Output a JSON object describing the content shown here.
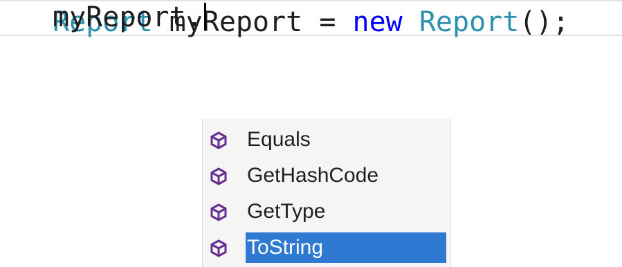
{
  "editor": {
    "line1": {
      "type_name": "Report",
      "space1": " ",
      "identifier": "myReport",
      "assign": " = ",
      "keyword": "new",
      "space2": " ",
      "constructor": "Report",
      "tail": "();"
    },
    "line2": {
      "text": "myReport."
    }
  },
  "completion": {
    "items": [
      {
        "label": "Equals",
        "icon": "method-icon"
      },
      {
        "label": "GetHashCode",
        "icon": "method-icon"
      },
      {
        "label": "GetType",
        "icon": "method-icon"
      },
      {
        "label": "ToString",
        "icon": "method-icon"
      }
    ],
    "selected_label": "ToString"
  },
  "colors": {
    "type_name": "#2b91af",
    "keyword": "#0000ff",
    "selection": "#3079d2",
    "method_icon": "#652d90"
  }
}
